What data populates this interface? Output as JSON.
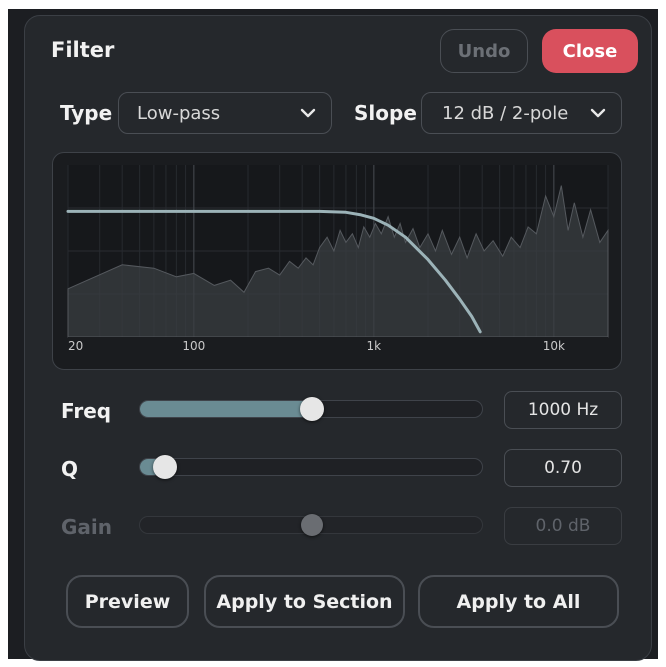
{
  "dialog": {
    "title": "Filter",
    "undo_label": "Undo",
    "close_label": "Close",
    "undo_enabled": false
  },
  "type_select": {
    "label": "Type",
    "value": "Low-pass"
  },
  "slope_select": {
    "label": "Slope",
    "value": "12 dB / 2-pole"
  },
  "chart_data": {
    "type": "line",
    "x_scale": "log",
    "xlim": [
      20,
      20000
    ],
    "ylim": [
      0,
      1
    ],
    "x_ticks": [
      {
        "value": 20,
        "label": "20"
      },
      {
        "value": 100,
        "label": "100"
      },
      {
        "value": 1000,
        "label": "1k"
      },
      {
        "value": 10000,
        "label": "10k"
      }
    ],
    "series": [
      {
        "role": "spectrum-area",
        "points": [
          [
            20,
            0.28
          ],
          [
            40,
            0.42
          ],
          [
            60,
            0.4
          ],
          [
            80,
            0.35
          ],
          [
            100,
            0.37
          ],
          [
            130,
            0.3
          ],
          [
            160,
            0.33
          ],
          [
            190,
            0.26
          ],
          [
            220,
            0.38
          ],
          [
            260,
            0.4
          ],
          [
            300,
            0.36
          ],
          [
            340,
            0.44
          ],
          [
            380,
            0.4
          ],
          [
            420,
            0.46
          ],
          [
            460,
            0.42
          ],
          [
            500,
            0.52
          ],
          [
            550,
            0.58
          ],
          [
            600,
            0.5
          ],
          [
            650,
            0.62
          ],
          [
            700,
            0.55
          ],
          [
            760,
            0.6
          ],
          [
            820,
            0.52
          ],
          [
            880,
            0.64
          ],
          [
            950,
            0.58
          ],
          [
            1020,
            0.66
          ],
          [
            1100,
            0.6
          ],
          [
            1200,
            0.7
          ],
          [
            1300,
            0.58
          ],
          [
            1400,
            0.66
          ],
          [
            1500,
            0.55
          ],
          [
            1650,
            0.63
          ],
          [
            1800,
            0.52
          ],
          [
            2000,
            0.6
          ],
          [
            2200,
            0.5
          ],
          [
            2400,
            0.62
          ],
          [
            2700,
            0.48
          ],
          [
            3000,
            0.58
          ],
          [
            3300,
            0.46
          ],
          [
            3700,
            0.6
          ],
          [
            4100,
            0.5
          ],
          [
            4600,
            0.56
          ],
          [
            5200,
            0.47
          ],
          [
            5800,
            0.58
          ],
          [
            6500,
            0.52
          ],
          [
            7200,
            0.64
          ],
          [
            8000,
            0.6
          ],
          [
            9000,
            0.82
          ],
          [
            10000,
            0.7
          ],
          [
            11000,
            0.88
          ],
          [
            12000,
            0.62
          ],
          [
            13000,
            0.78
          ],
          [
            14500,
            0.58
          ],
          [
            16000,
            0.74
          ],
          [
            18000,
            0.55
          ],
          [
            20000,
            0.62
          ]
        ]
      },
      {
        "role": "filter-response",
        "cutoff_hz": 1000,
        "points": [
          [
            20,
            0.73
          ],
          [
            100,
            0.73
          ],
          [
            300,
            0.73
          ],
          [
            500,
            0.73
          ],
          [
            700,
            0.725
          ],
          [
            850,
            0.71
          ],
          [
            1000,
            0.69
          ],
          [
            1200,
            0.65
          ],
          [
            1500,
            0.58
          ],
          [
            2000,
            0.45
          ],
          [
            2500,
            0.33
          ],
          [
            3000,
            0.22
          ],
          [
            3500,
            0.12
          ],
          [
            3900,
            0.03
          ]
        ]
      }
    ]
  },
  "controls": {
    "freq": {
      "label": "Freq",
      "value_text": "1000 Hz",
      "position": 0.5,
      "enabled": true
    },
    "q": {
      "label": "Q",
      "value_text": "0.70",
      "position": 0.05,
      "enabled": true
    },
    "gain": {
      "label": "Gain",
      "value_text": "0.0 dB",
      "position": 0.5,
      "enabled": false
    }
  },
  "actions": {
    "preview_label": "Preview",
    "apply_section_label": "Apply to Section",
    "apply_all_label": "Apply to All"
  },
  "colors": {
    "accent": "#6a8b93",
    "close": "#d9505d",
    "response_line": "#9cb3b8"
  }
}
